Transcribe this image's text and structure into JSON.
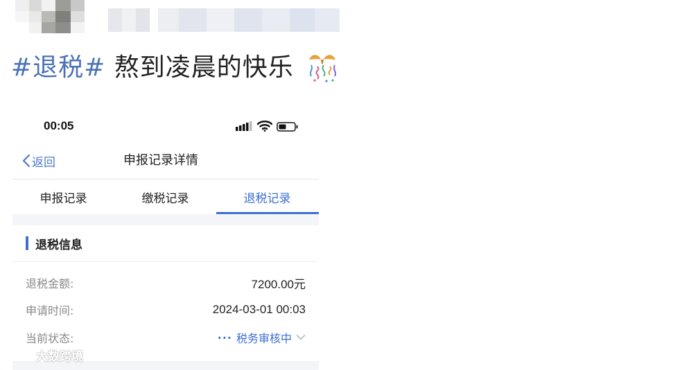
{
  "post": {
    "hashtag": "#退税#",
    "text": " 熬到凌晨的快乐",
    "emoji_icon": "party-popper-icon"
  },
  "phone": {
    "status_bar": {
      "time": "00:05",
      "icons": [
        "signal-icon",
        "wifi-icon",
        "battery-icon"
      ]
    },
    "nav": {
      "back_label": "返回",
      "title": "申报记录详情"
    },
    "tabs": [
      {
        "label": "申报记录",
        "active": false
      },
      {
        "label": "缴税记录",
        "active": false
      },
      {
        "label": "退税记录",
        "active": true
      }
    ],
    "section": {
      "title": "退税信息"
    },
    "fields": [
      {
        "label": "退税金额:",
        "value": "7200.00元"
      },
      {
        "label": "申请时间:",
        "value": "2024-03-01 00:03"
      },
      {
        "label": "当前状态:",
        "value": "税务审核中"
      }
    ],
    "colors": {
      "accent": "#3d6fd1",
      "label_gray": "#888888",
      "band_gray": "#f4f5f8"
    }
  },
  "watermark": {
    "text": "大数跨境"
  }
}
